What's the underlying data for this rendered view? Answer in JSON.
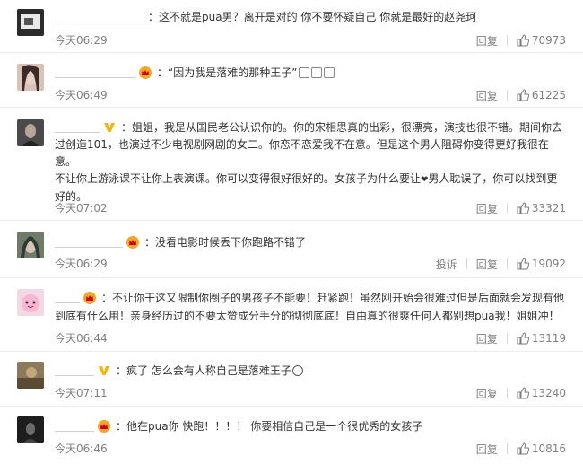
{
  "comments": [
    {
      "text": "：这不就是pua男？离开是对的 你不要怀疑自己 你就是最好的赵尧珂",
      "time": "今天06:29",
      "reply": "回复",
      "likes": "70973"
    },
    {
      "text": "：“因为我是落难的那种王子”",
      "time": "今天06:49",
      "reply": "回复",
      "likes": "61225"
    },
    {
      "text_line1": "：姐姐，我是从国民老公认识你的。你的宋相思真的出彩，很漂亮，演技也很不错。期间你去",
      "text_line2": "过创造101，也演过不少电视剧网剧的女二。你恋不恋爱我不在意。但是这个男人阻碍你变得更好我很在意。",
      "text_line3a": "不让你上游泳课不让你上表演课。你可以变得很好很好的。女孩子为什么要让",
      "text_line3b": "男人耽误了，你可以找到更",
      "text_line4": "好的。",
      "time": "今天07:02",
      "reply": "回复",
      "likes": "33321"
    },
    {
      "text": "：没看电影时候丢下你跑路不错了",
      "time": "今天06:29",
      "report": "投诉",
      "reply": "回复",
      "likes": "19092"
    },
    {
      "text_line1": "：不让你干这又限制你圈子的男孩子不能要！赶紧跑！虽然刚开始会很难过但是后面就会发现有他",
      "text_line2": "到底有什么用！亲身经历过的不要太赞成分手分的彻彻底底！自由真的很爽任何人都别想pua我！姐姐冲！",
      "time": "今天06:44",
      "reply": "回复",
      "likes": "13119"
    },
    {
      "text": "：疯了 怎么会有人称自己是落难王子",
      "time": "今天07:11",
      "reply": "回复",
      "likes": "13240"
    },
    {
      "text": "：他在pua你 快跑！！！！ 你要相信自己是一个很优秀的女孩子",
      "time": "今天06:46",
      "reply": "回复",
      "likes": "10816"
    }
  ],
  "colors": {
    "text": "#333333",
    "meta": "#808080",
    "crown": "#f5a623",
    "vip": "#f7b500",
    "divider": "#ececec"
  },
  "icons": {
    "like": "thumbs-up-icon",
    "crown": "crown-badge-icon",
    "vip": "v-badge-icon"
  }
}
